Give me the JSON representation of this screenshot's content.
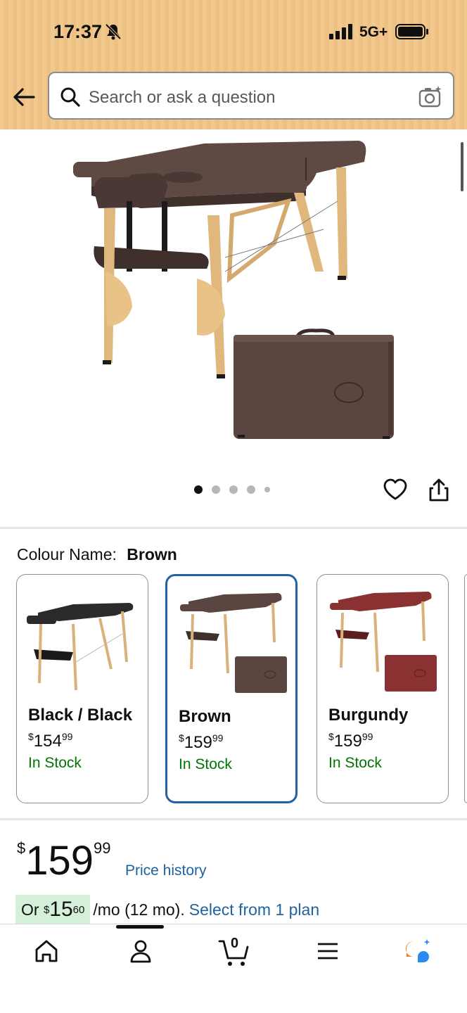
{
  "status_bar": {
    "time": "17:37",
    "network": "5G+"
  },
  "search": {
    "placeholder": "Search or ask a question"
  },
  "gallery": {
    "image_count": 5,
    "active_index": 0
  },
  "colour": {
    "label": "Colour Name:",
    "selected": "Brown",
    "options": [
      {
        "name": "Black / Black",
        "price_symbol": "$",
        "price_whole": "154",
        "price_cents": "99",
        "stock": "In Stock",
        "color": "#2b2b2b"
      },
      {
        "name": "Brown",
        "price_symbol": "$",
        "price_whole": "159",
        "price_cents": "99",
        "stock": "In Stock",
        "color": "#5b4540"
      },
      {
        "name": "Burgundy",
        "price_symbol": "$",
        "price_whole": "159",
        "price_cents": "99",
        "stock": "In Stock",
        "color": "#8a3232"
      }
    ]
  },
  "price": {
    "symbol": "$",
    "whole": "159",
    "cents": "99",
    "history_link": "Price history"
  },
  "installment": {
    "prefix": "Or",
    "symbol": "$",
    "whole": "15",
    "cents": "60",
    "suffix": "/mo (12 mo).",
    "link": "Select from 1 plan"
  },
  "bottom_nav": {
    "items": [
      "home-icon",
      "account-icon",
      "cart-icon",
      "menu-icon",
      "rufus-icon"
    ],
    "cart_count": "0"
  },
  "colors": {
    "link": "#2162a1",
    "stock": "#007600",
    "selected_border": "#2162a1",
    "header": "#f2c98d"
  }
}
